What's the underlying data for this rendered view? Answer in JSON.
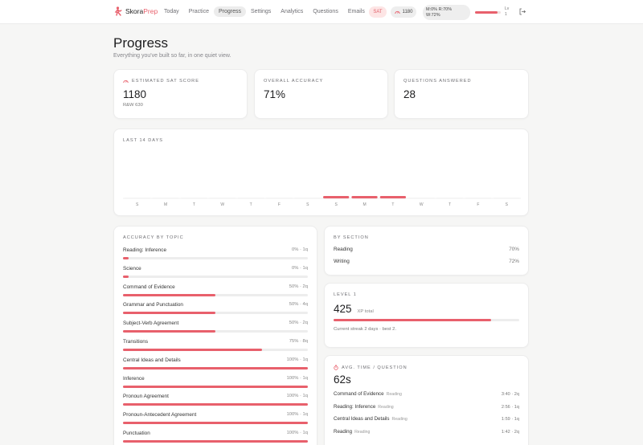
{
  "nav": {
    "brand_prefix": "Skora",
    "brand_suffix": "Prep",
    "tabs": [
      {
        "label": "Today",
        "active": false
      },
      {
        "label": "Practice",
        "active": false
      },
      {
        "label": "Progress",
        "active": true
      },
      {
        "label": "Settings",
        "active": false
      },
      {
        "label": "Analytics",
        "active": false
      },
      {
        "label": "Questions",
        "active": false
      },
      {
        "label": "Emails",
        "active": false
      }
    ],
    "exam_chip": "SAT",
    "score_chip": "1180",
    "mix_line1": "M:0% R:70%",
    "mix_line2": "W:72%",
    "level_label": "Lv",
    "level_num": "1",
    "xp_progress": 0.88,
    "icons": {
      "brand": "brand-logo-icon",
      "score": "gauge-icon",
      "logout": "logout-icon"
    }
  },
  "header": {
    "title": "Progress",
    "subtitle": "Everything you've built so far, in one quiet view."
  },
  "stats": {
    "sat": {
      "label": "Estimated SAT score",
      "value": "1180",
      "sub": "R&W 630",
      "icon": "gauge-icon"
    },
    "accuracy": {
      "label": "Overall accuracy",
      "value": "71%"
    },
    "answered": {
      "label": "Questions answered",
      "value": "28"
    }
  },
  "chart_data": {
    "type": "bar",
    "title": "LAST 14 DAYS",
    "categories": [
      "S",
      "M",
      "T",
      "W",
      "T",
      "F",
      "S",
      "S",
      "M",
      "T",
      "W",
      "T",
      "F",
      "S"
    ],
    "values": [
      0,
      0,
      0,
      0,
      0,
      0,
      0,
      1,
      1,
      1,
      0,
      0,
      0,
      0
    ],
    "xlabel": "",
    "ylabel": "",
    "grid": false
  },
  "topics": {
    "label": "Accuracy by topic",
    "items": [
      {
        "name": "Reading: Inference",
        "meta": "0% · 1q",
        "pct": 0
      },
      {
        "name": "Science",
        "meta": "0% · 1q",
        "pct": 0
      },
      {
        "name": "Command of Evidence",
        "meta": "50% · 2q",
        "pct": 50
      },
      {
        "name": "Grammar and Punctuation",
        "meta": "50% · 4q",
        "pct": 50
      },
      {
        "name": "Subject-Verb Agreement",
        "meta": "50% · 2q",
        "pct": 50
      },
      {
        "name": "Transitions",
        "meta": "75% · 8q",
        "pct": 75
      },
      {
        "name": "Central Ideas and Details",
        "meta": "100% · 1q",
        "pct": 100
      },
      {
        "name": "Inference",
        "meta": "100% · 1q",
        "pct": 100
      },
      {
        "name": "Pronoun Agreement",
        "meta": "100% · 1q",
        "pct": 100
      },
      {
        "name": "Pronoun-Antecedent Agreement",
        "meta": "100% · 1q",
        "pct": 100
      },
      {
        "name": "Punctuation",
        "meta": "100% · 1q",
        "pct": 100
      }
    ]
  },
  "sections": {
    "label": "By section",
    "items": [
      {
        "name": "Reading",
        "value": "70%"
      },
      {
        "name": "Writing",
        "value": "72%"
      }
    ]
  },
  "level": {
    "label": "Level 1",
    "value": "425",
    "unit": "XP total",
    "progress": 0.85,
    "note": "Current streak 2 days · best 2."
  },
  "avg_time": {
    "label": "Avg. time / question",
    "icon": "stopwatch-icon",
    "value": "62s",
    "items": [
      {
        "name": "Command of Evidence",
        "tag": "Reading",
        "value": "3:40 · 2q"
      },
      {
        "name": "Reading: Inference",
        "tag": "Reading",
        "value": "2:56 · 1q"
      },
      {
        "name": "Central Ideas and Details",
        "tag": "Reading",
        "value": "1:59 · 1q"
      },
      {
        "name": "Reading",
        "tag": "Reading",
        "value": "1:42 · 2q"
      }
    ]
  },
  "colors": {
    "accent": "#e8606c",
    "track": "#ededed",
    "muted": "#86868b"
  }
}
